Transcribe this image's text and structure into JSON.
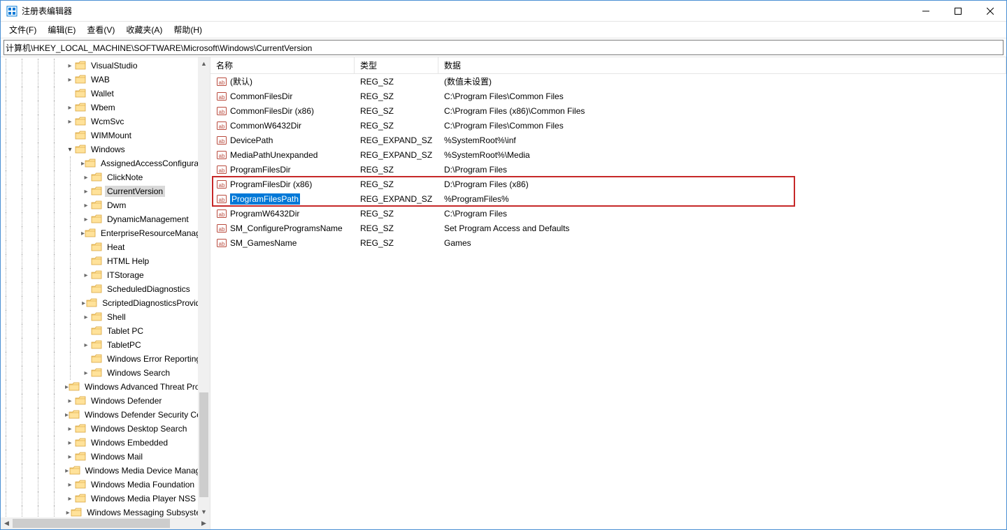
{
  "window": {
    "title": "注册表编辑器"
  },
  "menu": {
    "file": "文件(F)",
    "edit": "编辑(E)",
    "view": "查看(V)",
    "favorites": "收藏夹(A)",
    "help": "帮助(H)"
  },
  "address": "计算机\\HKEY_LOCAL_MACHINE\\SOFTWARE\\Microsoft\\Windows\\CurrentVersion",
  "tree": [
    {
      "depth": 4,
      "twisty": ">",
      "label": "VisualStudio"
    },
    {
      "depth": 4,
      "twisty": ">",
      "label": "WAB"
    },
    {
      "depth": 4,
      "twisty": "",
      "label": "Wallet"
    },
    {
      "depth": 4,
      "twisty": ">",
      "label": "Wbem"
    },
    {
      "depth": 4,
      "twisty": ">",
      "label": "WcmSvc"
    },
    {
      "depth": 4,
      "twisty": "",
      "label": "WIMMount"
    },
    {
      "depth": 4,
      "twisty": "v",
      "label": "Windows"
    },
    {
      "depth": 5,
      "twisty": ">",
      "label": "AssignedAccessConfiguration"
    },
    {
      "depth": 5,
      "twisty": ">",
      "label": "ClickNote"
    },
    {
      "depth": 5,
      "twisty": ">",
      "label": "CurrentVersion",
      "selected": true
    },
    {
      "depth": 5,
      "twisty": ">",
      "label": "Dwm"
    },
    {
      "depth": 5,
      "twisty": ">",
      "label": "DynamicManagement"
    },
    {
      "depth": 5,
      "twisty": ">",
      "label": "EnterpriseResourceManager"
    },
    {
      "depth": 5,
      "twisty": "",
      "label": "Heat"
    },
    {
      "depth": 5,
      "twisty": "",
      "label": "HTML Help"
    },
    {
      "depth": 5,
      "twisty": ">",
      "label": "ITStorage"
    },
    {
      "depth": 5,
      "twisty": "",
      "label": "ScheduledDiagnostics"
    },
    {
      "depth": 5,
      "twisty": ">",
      "label": "ScriptedDiagnosticsProvider"
    },
    {
      "depth": 5,
      "twisty": ">",
      "label": "Shell"
    },
    {
      "depth": 5,
      "twisty": "",
      "label": "Tablet PC"
    },
    {
      "depth": 5,
      "twisty": ">",
      "label": "TabletPC"
    },
    {
      "depth": 5,
      "twisty": "",
      "label": "Windows Error Reporting"
    },
    {
      "depth": 5,
      "twisty": ">",
      "label": "Windows Search"
    },
    {
      "depth": 4,
      "twisty": ">",
      "label": "Windows Advanced Threat Protection"
    },
    {
      "depth": 4,
      "twisty": ">",
      "label": "Windows Defender"
    },
    {
      "depth": 4,
      "twisty": ">",
      "label": "Windows Defender Security Center"
    },
    {
      "depth": 4,
      "twisty": ">",
      "label": "Windows Desktop Search"
    },
    {
      "depth": 4,
      "twisty": ">",
      "label": "Windows Embedded"
    },
    {
      "depth": 4,
      "twisty": ">",
      "label": "Windows Mail"
    },
    {
      "depth": 4,
      "twisty": ">",
      "label": "Windows Media Device Manager"
    },
    {
      "depth": 4,
      "twisty": ">",
      "label": "Windows Media Foundation"
    },
    {
      "depth": 4,
      "twisty": ">",
      "label": "Windows Media Player NSS"
    },
    {
      "depth": 4,
      "twisty": ">",
      "label": "Windows Messaging Subsystem"
    }
  ],
  "columns": {
    "name": "名称",
    "type": "类型",
    "data": "数据"
  },
  "values": [
    {
      "name": "(默认)",
      "type": "REG_SZ",
      "data": "(数值未设置)"
    },
    {
      "name": "CommonFilesDir",
      "type": "REG_SZ",
      "data": "C:\\Program Files\\Common Files"
    },
    {
      "name": "CommonFilesDir (x86)",
      "type": "REG_SZ",
      "data": "C:\\Program Files (x86)\\Common Files"
    },
    {
      "name": "CommonW6432Dir",
      "type": "REG_SZ",
      "data": "C:\\Program Files\\Common Files"
    },
    {
      "name": "DevicePath",
      "type": "REG_EXPAND_SZ",
      "data": "%SystemRoot%\\inf"
    },
    {
      "name": "MediaPathUnexpanded",
      "type": "REG_EXPAND_SZ",
      "data": "%SystemRoot%\\Media"
    },
    {
      "name": "ProgramFilesDir",
      "type": "REG_SZ",
      "data": "D:\\Program Files"
    },
    {
      "name": "ProgramFilesDir (x86)",
      "type": "REG_SZ",
      "data": "D:\\Program Files (x86)"
    },
    {
      "name": "ProgramFilesPath",
      "type": "REG_EXPAND_SZ",
      "data": "%ProgramFiles%",
      "selected": true
    },
    {
      "name": "ProgramW6432Dir",
      "type": "REG_SZ",
      "data": "C:\\Program Files"
    },
    {
      "name": "SM_ConfigureProgramsName",
      "type": "REG_SZ",
      "data": "Set Program Access and Defaults"
    },
    {
      "name": "SM_GamesName",
      "type": "REG_SZ",
      "data": "Games"
    }
  ],
  "highlight": {
    "startRow": 7,
    "endRow": 8
  }
}
